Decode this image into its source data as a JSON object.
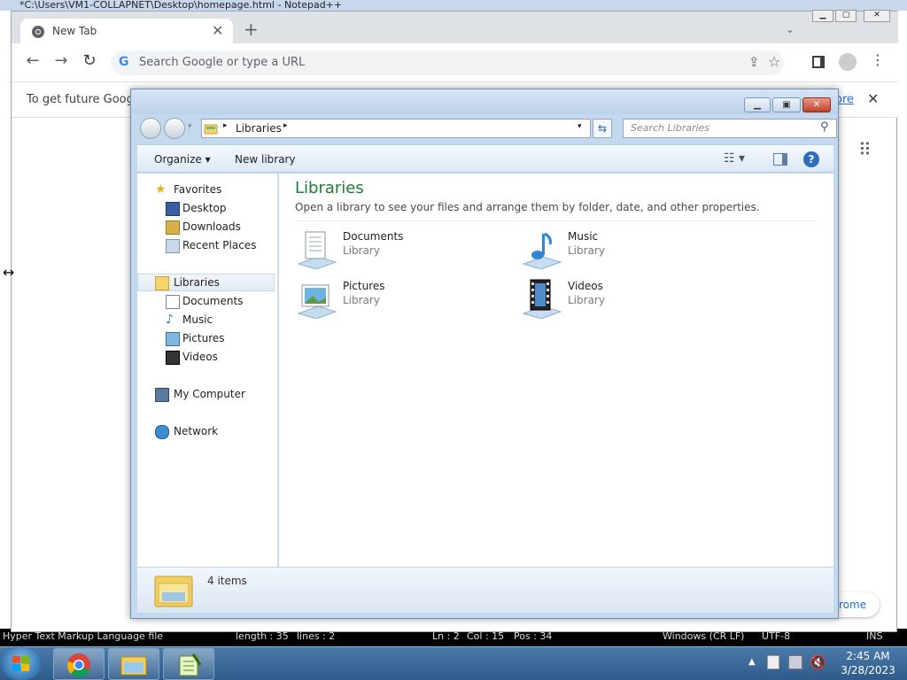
{
  "notepad": {
    "title": "*C:\\Users\\VM1-COLLAPNET\\Desktop\\homepage.html - Notepad++",
    "status": {
      "lang": "Hyper Text Markup Language file",
      "length": "length : 35",
      "lines": "lines : 2",
      "ln": "Ln : 2",
      "col": "Col : 15",
      "pos": "Pos : 34",
      "eol": "Windows (CR LF)",
      "enc": "UTF-8",
      "ins": "INS"
    }
  },
  "chrome": {
    "tab_title": "New Tab",
    "omnibox_placeholder": "Search Google or type a URL",
    "infobar_text": "To get future Google",
    "infobar_link": "ore",
    "bottom_chip": "rome"
  },
  "explorer": {
    "breadcrumb": "Libraries",
    "search_placeholder": "Search Libraries",
    "toolbar": {
      "organize": "Organize",
      "new_library": "New library"
    },
    "nav": {
      "favorites": "Favorites",
      "favorites_items": [
        "Desktop",
        "Downloads",
        "Recent Places"
      ],
      "libraries": "Libraries",
      "libraries_items": [
        "Documents",
        "Music",
        "Pictures",
        "Videos"
      ],
      "computer": "My Computer",
      "network": "Network"
    },
    "content": {
      "heading": "Libraries",
      "description": "Open a library to see your files and arrange them by folder, date, and other properties.",
      "tiles": [
        {
          "name": "Documents",
          "type": "Library",
          "icon": "documents-library-icon"
        },
        {
          "name": "Music",
          "type": "Library",
          "icon": "music-library-icon"
        },
        {
          "name": "Pictures",
          "type": "Library",
          "icon": "pictures-library-icon"
        },
        {
          "name": "Videos",
          "type": "Library",
          "icon": "videos-library-icon"
        }
      ]
    },
    "details": {
      "count": "4 items"
    }
  },
  "taskbar": {
    "time": "2:45 AM",
    "date": "3/28/2023"
  },
  "colors": {
    "explorer_heading": "#1e7a3a",
    "chrome_link": "#1a73e8",
    "taskbar": "#2f5b8a"
  }
}
